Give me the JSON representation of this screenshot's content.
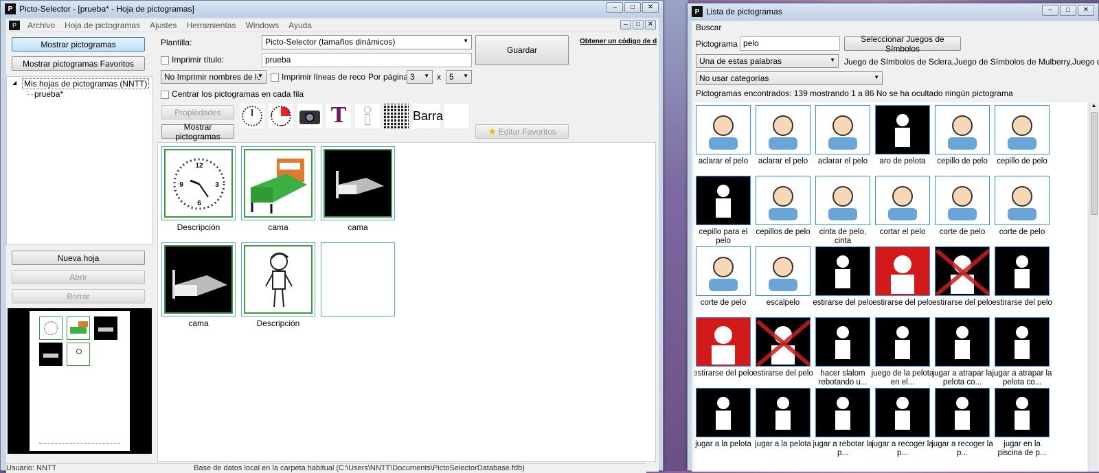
{
  "left_window": {
    "title": "Picto-Selector - [prueba* - Hoja de pictogramas]",
    "menu": [
      "Archivo",
      "Hoja de pictogramas",
      "Ajustes",
      "Herramientas",
      "Windows",
      "Ayuda"
    ],
    "show_pictos_button": "Mostrar pictogramas",
    "show_fav_button": "Mostrar pictogramas Favoritos",
    "tree_root": "Mis hojas de pictogramas (NNTT)",
    "tree_child": "prueba*",
    "new_sheet_button": "Nueva hoja",
    "open_button": "Abrir",
    "delete_button": "Borrar",
    "template_label": "Plantilla:",
    "template_value": "Picto-Selector (tamaños dinámicos)",
    "save_button": "Guardar",
    "obtain_link": "Obtener un código de d",
    "print_title_label": "Imprimir título:",
    "title_value": "prueba",
    "print_names_select": "No Imprimir nombres de lo",
    "print_lines_label": "Imprimir líneas de reco",
    "per_page_label": "Por página",
    "rows_value": "3",
    "x_label": "x",
    "cols_value": "5",
    "center_label": "Centrar los pictogramas en cada fila",
    "properties_button": "Propiedades",
    "barra_label": "Barra",
    "show_pictos_button2": "Mostrar pictogramas",
    "edit_fav_button": "Editar Favoritos",
    "sheet_labels": [
      "Descripción",
      "cama",
      "cama",
      "cama",
      "Descripción"
    ],
    "status_user": "Usuario: NNTT",
    "status_db": "Base de datos local en la carpeta habitual (C:\\Users\\NNTT\\Documents\\PictoSelectorDatabase.fdb)"
  },
  "right_window": {
    "title": "Lista de pictogramas",
    "search_menu": "Buscar",
    "picto_label": "Pictograma",
    "picto_value": "pelo",
    "select_sets_button": "Seleccionar Juegos de Símbolos",
    "match_select": "Una de estas palabras",
    "sets_text": "Juego de Símbolos de Sclera,Juego de Símbolos de Mulberry,Juego de S",
    "category_select": "No usar categorías",
    "found_text": "Pictogramas encontrados: 139 mostrando 1 a 86 No se ha ocultado ningún pictograma",
    "results": [
      {
        "label": "aclarar el pelo",
        "style": "white"
      },
      {
        "label": "aclarar el pelo",
        "style": "white"
      },
      {
        "label": "aclarar el pelo",
        "style": "white"
      },
      {
        "label": "aro de pelota",
        "style": "black"
      },
      {
        "label": "cepillo de pelo",
        "style": "white"
      },
      {
        "label": "cepillo de pelo",
        "style": "white"
      },
      {
        "label": "cepillo para el pelo",
        "style": "black"
      },
      {
        "label": "cepillos de pelo",
        "style": "white"
      },
      {
        "label": "cinta de pelo, cinta",
        "style": "white"
      },
      {
        "label": "cortar el pelo",
        "style": "white"
      },
      {
        "label": "corte de pelo",
        "style": "white"
      },
      {
        "label": "corte de pelo",
        "style": "white"
      },
      {
        "label": "corte de pelo",
        "style": "white"
      },
      {
        "label": "escalpelo",
        "style": "white"
      },
      {
        "label": "estirarse del pelo",
        "style": "black"
      },
      {
        "label": "estirarse del pelo",
        "style": "red"
      },
      {
        "label": "estirarse del pelo",
        "style": "cross"
      },
      {
        "label": "estirarse del pelo",
        "style": "black"
      },
      {
        "label": "estirarse del pelo",
        "style": "red"
      },
      {
        "label": "estirarse del pelo",
        "style": "cross"
      },
      {
        "label": "hacer slalom rebotando u...",
        "style": "black"
      },
      {
        "label": "juego de la pelota en el...",
        "style": "black"
      },
      {
        "label": "jugar a atrapar la pelota co...",
        "style": "black"
      },
      {
        "label": "jugar a atrapar la pelota co...",
        "style": "black"
      },
      {
        "label": "jugar a la pelota",
        "style": "black"
      },
      {
        "label": "jugar a la pelota",
        "style": "black"
      },
      {
        "label": "jugar a rebotar la p...",
        "style": "black"
      },
      {
        "label": "jugar a recoger la p...",
        "style": "black"
      },
      {
        "label": "jugar a recoger la p...",
        "style": "black"
      },
      {
        "label": "jugar en la piscina de p...",
        "style": "black"
      }
    ]
  }
}
